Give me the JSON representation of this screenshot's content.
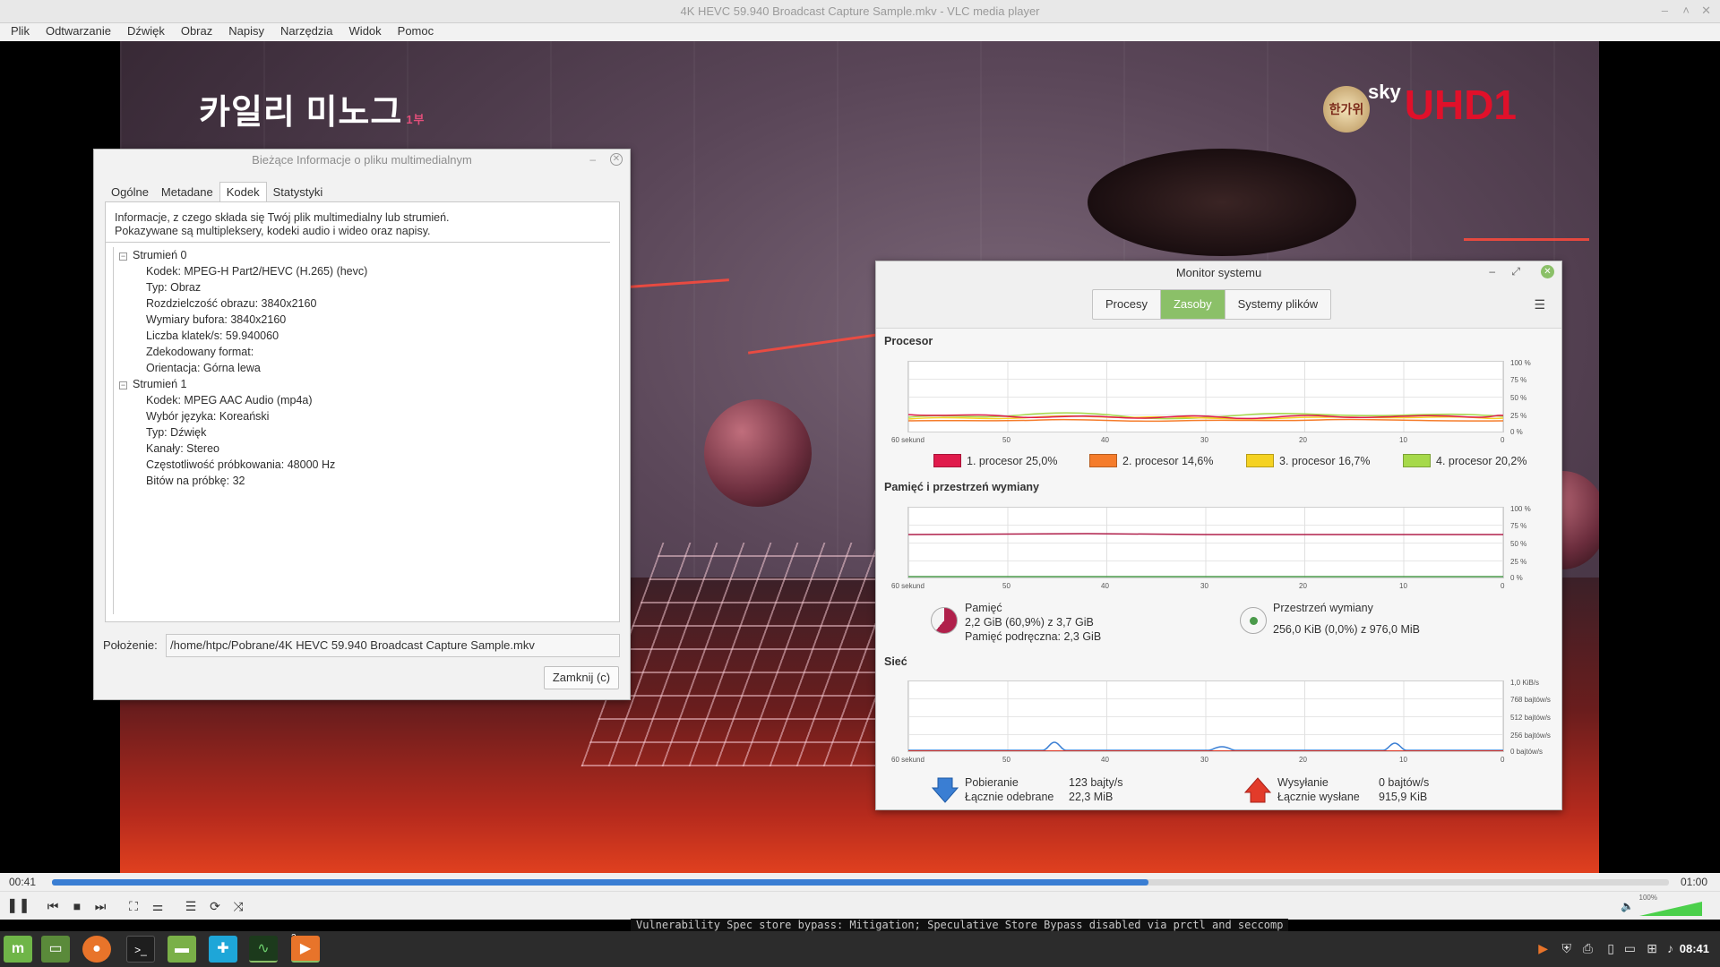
{
  "window": {
    "title": "4K HEVC 59.940 Broadcast Capture Sample.mkv - VLC media player",
    "minimize": "–",
    "maximize": "˄",
    "close": "✕"
  },
  "menu": [
    "Plik",
    "Odtwarzanie",
    "Dźwięk",
    "Obraz",
    "Napisy",
    "Narzędzia",
    "Widok",
    "Pomoc"
  ],
  "video": {
    "overlay_title": "카일리 미노그",
    "overlay_sub": "1부",
    "channel_sky": "sky",
    "channel_uhd_u": "U",
    "channel_uhd_rest": "HD1",
    "hangawi": "한가위"
  },
  "media_info": {
    "title": "Bieżące Informacje o pliku multimedialnym",
    "tabs": [
      "Ogólne",
      "Metadane",
      "Kodek",
      "Statystyki"
    ],
    "active_tab": "Kodek",
    "description_1": "Informacje, z czego składa się Twój plik multimedialny lub strumień.",
    "description_2": "Pokazywane są multipleksery, kodeki audio i wideo oraz napisy.",
    "stream0": {
      "label": "Strumień 0",
      "items": [
        "Kodek: MPEG-H Part2/HEVC (H.265) (hevc)",
        "Typ: Obraz",
        "Rozdzielczość obrazu: 3840x2160",
        "Wymiary bufora: 3840x2160",
        "Liczba klatek/s: 59.940060",
        "Zdekodowany format:",
        "Orientacja: Górna lewa"
      ]
    },
    "stream1": {
      "label": "Strumień 1",
      "items": [
        "Kodek: MPEG AAC Audio (mp4a)",
        "Wybór języka: Koreański",
        "Typ: Dźwięk",
        "Kanały: Stereo",
        "Częstotliwość próbkowania: 48000 Hz",
        "Bitów na próbkę: 32"
      ]
    },
    "location_label": "Położenie:",
    "location_value": "/home/htpc/Pobrane/4K HEVC 59.940 Broadcast Capture Sample.mkv",
    "close_label": "Zamknij (c)"
  },
  "sysmon": {
    "title": "Monitor systemu",
    "tabs": [
      "Procesy",
      "Zasoby",
      "Systemy plików"
    ],
    "active_tab": "Zasoby",
    "cpu_section": "Procesor",
    "mem_section": "Pamięć i przestrzeń wymiany",
    "net_section": "Sieć",
    "x_ticks": [
      "60 sekund",
      "50",
      "40",
      "30",
      "20",
      "10",
      "0"
    ],
    "pct_ticks": [
      "100 %",
      "75 %",
      "50 %",
      "25 %",
      "0 %"
    ],
    "net_ticks": [
      "1,0 KiB/s",
      "768 bajtów/s",
      "512 bajtów/s",
      "256 bajtów/s",
      "0 bajtów/s"
    ],
    "cpus": [
      {
        "label": "1. procesor",
        "value": "25,0%",
        "color": "#e01b4c"
      },
      {
        "label": "2. procesor",
        "value": "14,6%",
        "color": "#f57c2b"
      },
      {
        "label": "3. procesor",
        "value": "16,7%",
        "color": "#f5d222"
      },
      {
        "label": "4. procesor",
        "value": "20,2%",
        "color": "#a6d94a"
      }
    ],
    "memory": {
      "label": "Pamięć",
      "used": "2,2 GiB (60,9%) z 3,7 GiB",
      "cache": "Pamięć podręczna: 2,3 GiB",
      "percent": 60.9,
      "color": "#b0204b"
    },
    "swap": {
      "label": "Przestrzeń wymiany",
      "used": "256,0 KiB (0,0%) z 976,0 MiB",
      "color": "#4a9a4a"
    },
    "network": {
      "down_label": "Pobieranie",
      "down_total_label": "Łącznie odebrane",
      "down_rate": "123 bajty/s",
      "down_total": "22,3 MiB",
      "up_label": "Wysyłanie",
      "up_total_label": "Łącznie wysłane",
      "up_rate": "0 bajtów/s",
      "up_total": "915,9 KiB"
    }
  },
  "playback": {
    "elapsed": "00:41",
    "total": "01:00",
    "progress": 0.678,
    "volume_label": "100%",
    "volume": 1.0
  },
  "console_text": "Vulnerability Spec store bypass: Mitigation; Speculative Store Bypass disabled via prctl and seccomp",
  "taskbar": {
    "badge": "2",
    "clock": "08:41"
  }
}
